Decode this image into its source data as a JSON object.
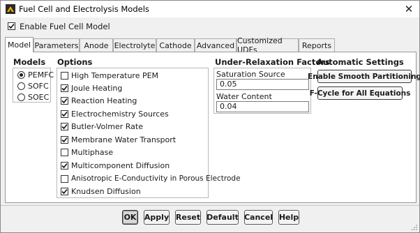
{
  "window": {
    "title": "Fuel Cell and Electrolysis Models",
    "close_glyph": "✕",
    "icon": "app-logo-icon"
  },
  "enable": {
    "label": "Enable Fuel Cell Model",
    "checked": true
  },
  "tabs": [
    {
      "label": "Model",
      "active": true
    },
    {
      "label": "Parameters"
    },
    {
      "label": "Anode"
    },
    {
      "label": "Electrolyte"
    },
    {
      "label": "Cathode"
    },
    {
      "label": "Advanced"
    },
    {
      "label": "Customized UDFs"
    },
    {
      "label": "Reports"
    }
  ],
  "models": {
    "title": "Models",
    "items": [
      {
        "label": "PEMFC",
        "selected": true
      },
      {
        "label": "SOFC",
        "selected": false
      },
      {
        "label": "SOEC",
        "selected": false
      }
    ]
  },
  "options": {
    "title": "Options",
    "items": [
      {
        "label": "High Temperature PEM",
        "checked": false
      },
      {
        "label": "Joule Heating",
        "checked": true
      },
      {
        "label": "Reaction Heating",
        "checked": true
      },
      {
        "label": "Electrochemistry Sources",
        "checked": true
      },
      {
        "label": "Butler-Volmer Rate",
        "checked": true
      },
      {
        "label": "Membrane Water Transport",
        "checked": true
      },
      {
        "label": "Multiphase",
        "checked": false
      },
      {
        "label": "Multicomponent Diffusion",
        "checked": true
      },
      {
        "label": "Anisotropic E-Conductivity in Porous Electrode",
        "checked": false
      },
      {
        "label": "Knudsen Diffusion",
        "checked": true
      }
    ]
  },
  "urf": {
    "title": "Under-Relaxation Factors",
    "saturation_label": "Saturation Source",
    "saturation_value": "0.05",
    "water_label": "Water Content",
    "water_value": "0.04"
  },
  "auto": {
    "title": "Automatic Settings",
    "smooth_label": "Enable Smooth Partitioning",
    "fcycle_label": "F-Cycle for All Equations"
  },
  "buttons": {
    "ok": "OK",
    "apply": "Apply",
    "reset": "Reset",
    "default": "Default",
    "cancel": "Cancel",
    "help": "Help"
  }
}
